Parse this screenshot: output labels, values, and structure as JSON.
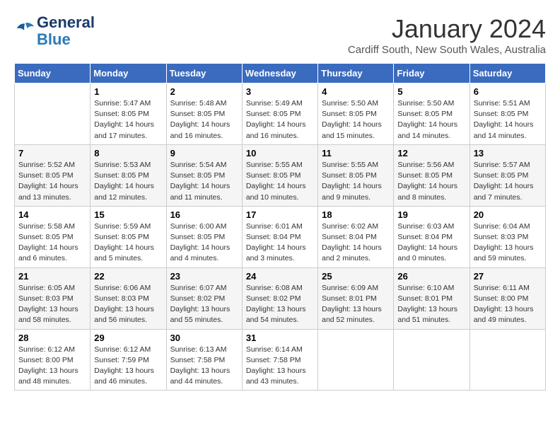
{
  "header": {
    "logo_line1": "General",
    "logo_line2": "Blue",
    "title": "January 2024",
    "subtitle": "Cardiff South, New South Wales, Australia"
  },
  "days_of_week": [
    "Sunday",
    "Monday",
    "Tuesday",
    "Wednesday",
    "Thursday",
    "Friday",
    "Saturday"
  ],
  "weeks": [
    [
      {
        "day": "",
        "info": ""
      },
      {
        "day": "1",
        "info": "Sunrise: 5:47 AM\nSunset: 8:05 PM\nDaylight: 14 hours\nand 17 minutes."
      },
      {
        "day": "2",
        "info": "Sunrise: 5:48 AM\nSunset: 8:05 PM\nDaylight: 14 hours\nand 16 minutes."
      },
      {
        "day": "3",
        "info": "Sunrise: 5:49 AM\nSunset: 8:05 PM\nDaylight: 14 hours\nand 16 minutes."
      },
      {
        "day": "4",
        "info": "Sunrise: 5:50 AM\nSunset: 8:05 PM\nDaylight: 14 hours\nand 15 minutes."
      },
      {
        "day": "5",
        "info": "Sunrise: 5:50 AM\nSunset: 8:05 PM\nDaylight: 14 hours\nand 14 minutes."
      },
      {
        "day": "6",
        "info": "Sunrise: 5:51 AM\nSunset: 8:05 PM\nDaylight: 14 hours\nand 14 minutes."
      }
    ],
    [
      {
        "day": "7",
        "info": "Sunrise: 5:52 AM\nSunset: 8:05 PM\nDaylight: 14 hours\nand 13 minutes."
      },
      {
        "day": "8",
        "info": "Sunrise: 5:53 AM\nSunset: 8:05 PM\nDaylight: 14 hours\nand 12 minutes."
      },
      {
        "day": "9",
        "info": "Sunrise: 5:54 AM\nSunset: 8:05 PM\nDaylight: 14 hours\nand 11 minutes."
      },
      {
        "day": "10",
        "info": "Sunrise: 5:55 AM\nSunset: 8:05 PM\nDaylight: 14 hours\nand 10 minutes."
      },
      {
        "day": "11",
        "info": "Sunrise: 5:55 AM\nSunset: 8:05 PM\nDaylight: 14 hours\nand 9 minutes."
      },
      {
        "day": "12",
        "info": "Sunrise: 5:56 AM\nSunset: 8:05 PM\nDaylight: 14 hours\nand 8 minutes."
      },
      {
        "day": "13",
        "info": "Sunrise: 5:57 AM\nSunset: 8:05 PM\nDaylight: 14 hours\nand 7 minutes."
      }
    ],
    [
      {
        "day": "14",
        "info": "Sunrise: 5:58 AM\nSunset: 8:05 PM\nDaylight: 14 hours\nand 6 minutes."
      },
      {
        "day": "15",
        "info": "Sunrise: 5:59 AM\nSunset: 8:05 PM\nDaylight: 14 hours\nand 5 minutes."
      },
      {
        "day": "16",
        "info": "Sunrise: 6:00 AM\nSunset: 8:05 PM\nDaylight: 14 hours\nand 4 minutes."
      },
      {
        "day": "17",
        "info": "Sunrise: 6:01 AM\nSunset: 8:04 PM\nDaylight: 14 hours\nand 3 minutes."
      },
      {
        "day": "18",
        "info": "Sunrise: 6:02 AM\nSunset: 8:04 PM\nDaylight: 14 hours\nand 2 minutes."
      },
      {
        "day": "19",
        "info": "Sunrise: 6:03 AM\nSunset: 8:04 PM\nDaylight: 14 hours\nand 0 minutes."
      },
      {
        "day": "20",
        "info": "Sunrise: 6:04 AM\nSunset: 8:03 PM\nDaylight: 13 hours\nand 59 minutes."
      }
    ],
    [
      {
        "day": "21",
        "info": "Sunrise: 6:05 AM\nSunset: 8:03 PM\nDaylight: 13 hours\nand 58 minutes."
      },
      {
        "day": "22",
        "info": "Sunrise: 6:06 AM\nSunset: 8:03 PM\nDaylight: 13 hours\nand 56 minutes."
      },
      {
        "day": "23",
        "info": "Sunrise: 6:07 AM\nSunset: 8:02 PM\nDaylight: 13 hours\nand 55 minutes."
      },
      {
        "day": "24",
        "info": "Sunrise: 6:08 AM\nSunset: 8:02 PM\nDaylight: 13 hours\nand 54 minutes."
      },
      {
        "day": "25",
        "info": "Sunrise: 6:09 AM\nSunset: 8:01 PM\nDaylight: 13 hours\nand 52 minutes."
      },
      {
        "day": "26",
        "info": "Sunrise: 6:10 AM\nSunset: 8:01 PM\nDaylight: 13 hours\nand 51 minutes."
      },
      {
        "day": "27",
        "info": "Sunrise: 6:11 AM\nSunset: 8:00 PM\nDaylight: 13 hours\nand 49 minutes."
      }
    ],
    [
      {
        "day": "28",
        "info": "Sunrise: 6:12 AM\nSunset: 8:00 PM\nDaylight: 13 hours\nand 48 minutes."
      },
      {
        "day": "29",
        "info": "Sunrise: 6:12 AM\nSunset: 7:59 PM\nDaylight: 13 hours\nand 46 minutes."
      },
      {
        "day": "30",
        "info": "Sunrise: 6:13 AM\nSunset: 7:58 PM\nDaylight: 13 hours\nand 44 minutes."
      },
      {
        "day": "31",
        "info": "Sunrise: 6:14 AM\nSunset: 7:58 PM\nDaylight: 13 hours\nand 43 minutes."
      },
      {
        "day": "",
        "info": ""
      },
      {
        "day": "",
        "info": ""
      },
      {
        "day": "",
        "info": ""
      }
    ]
  ]
}
